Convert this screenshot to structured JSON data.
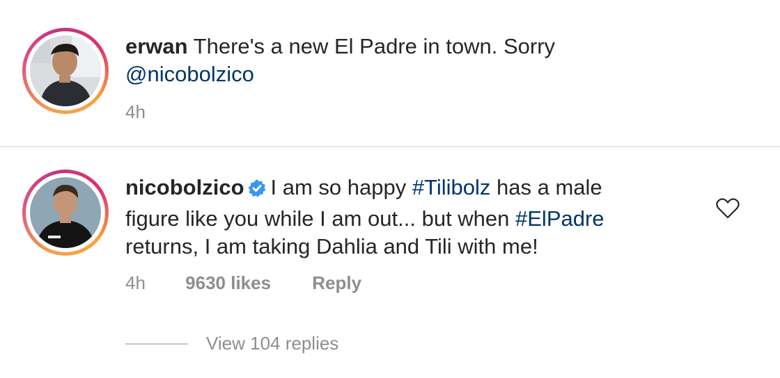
{
  "comments": [
    {
      "username": "erwan",
      "text_line1": " There's a new El Padre in town. Sorry",
      "mention": "@nicobolzico",
      "time": "4h",
      "avatar": "profile-photo-erwan"
    },
    {
      "username": "nicobolzico",
      "verified": true,
      "text_line1": "I am so happy ",
      "hashtag1": "#Tilibolz",
      "text_line1b": " has a male",
      "text_line2": "figure like you while I am out... but when ",
      "hashtag2": "#ElPadre",
      "text_line3": "returns, I am taking Dahlia and Tili with me!",
      "time": "4h",
      "likes": "9630 likes",
      "reply_label": "Reply",
      "view_replies": "View 104 replies",
      "like_icon": "heart-outline-icon",
      "avatar": "profile-photo-nicobolzico"
    }
  ],
  "colors": {
    "text": "#262626",
    "link": "#003569",
    "muted": "#8e8e8e",
    "verified": "#3897f0"
  }
}
